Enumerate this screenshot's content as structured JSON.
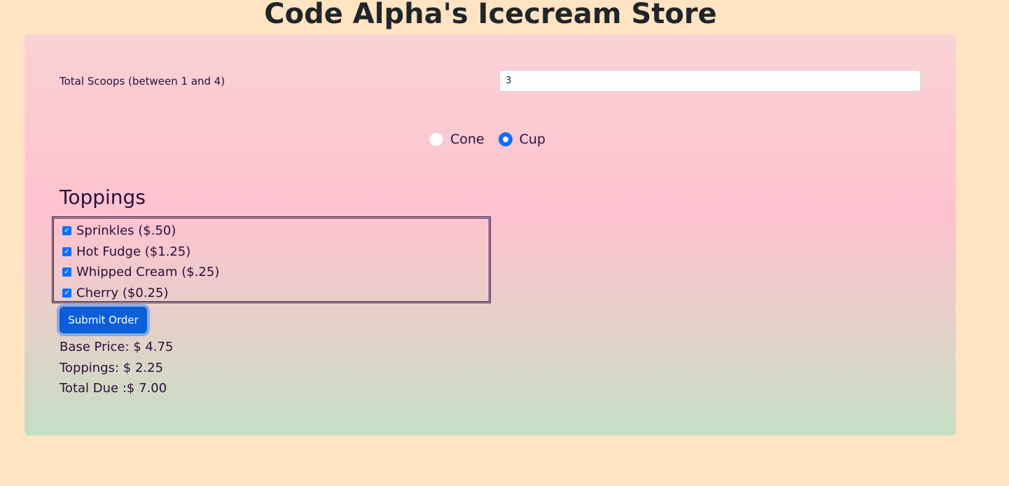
{
  "header": {
    "title": "Code Alpha's Icecream Store"
  },
  "form": {
    "scoops_label": "Total Scoops (between 1 and 4)",
    "scoops_value": "3",
    "container_options": [
      {
        "label": "Cone",
        "checked": false
      },
      {
        "label": "Cup",
        "checked": true
      }
    ],
    "toppings_heading": "Toppings",
    "toppings": [
      {
        "label": "Sprinkles ($.50)",
        "checked": true
      },
      {
        "label": "Hot Fudge ($1.25)",
        "checked": true
      },
      {
        "label": "Whipped Cream ($.25)",
        "checked": true
      },
      {
        "label": "Cherry ($0.25)",
        "checked": true
      }
    ],
    "submit_label": "Submit Order"
  },
  "summary": {
    "base_price": "Base Price: $ 4.75",
    "toppings": "Toppings: $ 2.25",
    "total_due": "Total Due :$ 7.00"
  },
  "colors": {
    "background": "#ffe4c3",
    "accent": "#0d6efd",
    "button": "#0b5ed7",
    "text": "#2a0f3a"
  }
}
